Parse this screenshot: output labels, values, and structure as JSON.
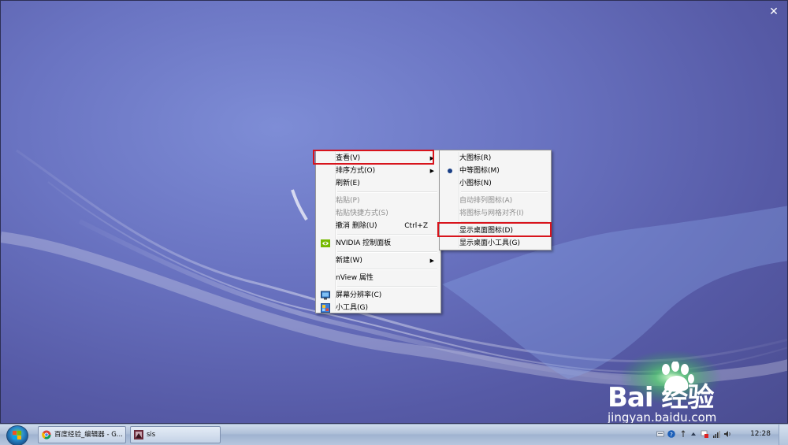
{
  "window": {
    "close_glyph": "✕"
  },
  "context_menu": {
    "items": [
      {
        "label": "查看(V)",
        "submenu": true
      },
      {
        "label": "排序方式(O)",
        "submenu": true
      },
      {
        "label": "刷新(E)"
      },
      {
        "label": "粘贴(P)",
        "disabled": true
      },
      {
        "label": "粘贴快捷方式(S)",
        "disabled": true
      },
      {
        "label": "撤消 删除(U)",
        "shortcut": "Ctrl+Z"
      },
      {
        "label": "NVIDIA 控制面板",
        "icon": "nvidia-icon"
      },
      {
        "label": "新建(W)",
        "submenu": true
      },
      {
        "label": "nView 属性"
      },
      {
        "label": "屏幕分辨率(C)",
        "icon": "monitor-icon"
      },
      {
        "label": "小工具(G)",
        "icon": "gadgets-icon"
      }
    ],
    "highlighted": "查看(V)"
  },
  "view_submenu": {
    "items": [
      {
        "label": "大图标(R)"
      },
      {
        "label": "中等图标(M)",
        "selected": true
      },
      {
        "label": "小图标(N)"
      },
      {
        "label": "自动排列图标(A)",
        "disabled": true
      },
      {
        "label": "将图标与网格对齐(I)",
        "disabled": true
      },
      {
        "label": "显示桌面图标(D)"
      },
      {
        "label": "显示桌面小工具(G)"
      }
    ],
    "highlighted": "显示桌面图标(D)"
  },
  "taskbar": {
    "buttons": [
      {
        "label": "百度经验_编辑器 - G...",
        "icon": "chrome-icon"
      },
      {
        "label": "sis",
        "icon": "app-icon"
      }
    ],
    "clock": "12:28",
    "tray_icons": [
      "keyboard-icon",
      "help-icon",
      "network-icon",
      "show-hidden-icon",
      "flag-icon",
      "signal-icon",
      "volume-icon"
    ]
  },
  "watermark": {
    "logo": "Bai 经验",
    "url": "jingyan.baidu.com"
  },
  "colors": {
    "highlight_box": "#d8141c",
    "desktop_base": "#5a5fa8"
  }
}
